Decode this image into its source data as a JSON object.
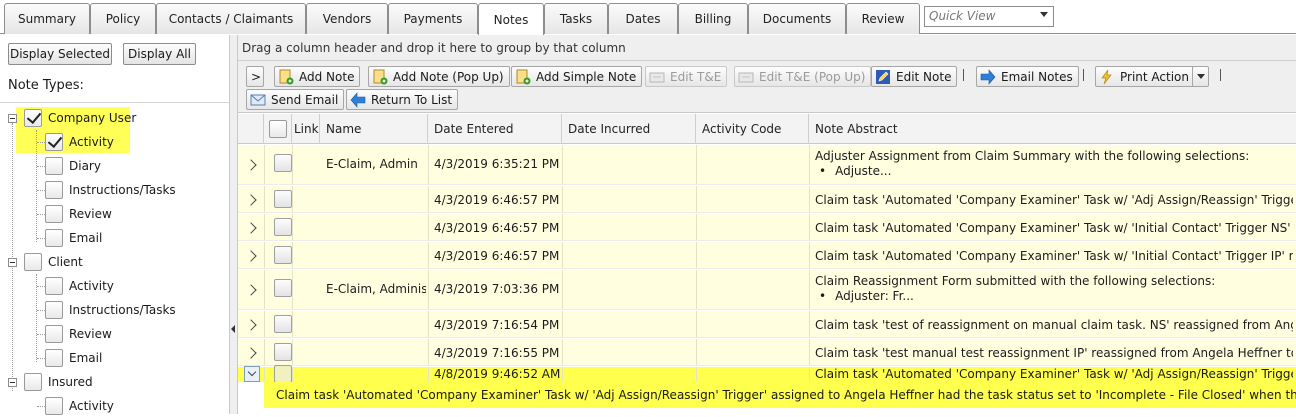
{
  "tabs": [
    {
      "label": "Summary",
      "active": false
    },
    {
      "label": "Policy",
      "active": false
    },
    {
      "label": "Contacts / Claimants",
      "active": false
    },
    {
      "label": "Vendors",
      "active": false
    },
    {
      "label": "Payments",
      "active": false
    },
    {
      "label": "Notes",
      "active": true
    },
    {
      "label": "Tasks",
      "active": false
    },
    {
      "label": "Dates",
      "active": false
    },
    {
      "label": "Billing",
      "active": false
    },
    {
      "label": "Documents",
      "active": false
    },
    {
      "label": "Review",
      "active": false
    }
  ],
  "quick_view": {
    "placeholder": "Quick View"
  },
  "left_panel": {
    "display_selected": "Display Selected",
    "display_all": "Display All",
    "note_types_label": "Note Types:",
    "tree": [
      {
        "label": "Company User",
        "checked": true,
        "highlight": true
      },
      {
        "label": "Activity",
        "checked": true,
        "highlight": true
      },
      {
        "label": "Diary",
        "checked": false
      },
      {
        "label": "Instructions/Tasks",
        "checked": false
      },
      {
        "label": "Review",
        "checked": false
      },
      {
        "label": "Email",
        "checked": false
      },
      {
        "label": "Client",
        "checked": false
      },
      {
        "label": "Activity",
        "checked": false
      },
      {
        "label": "Instructions/Tasks",
        "checked": false
      },
      {
        "label": "Review",
        "checked": false
      },
      {
        "label": "Email",
        "checked": false
      },
      {
        "label": "Insured",
        "checked": false
      },
      {
        "label": "Activity",
        "checked": false
      }
    ]
  },
  "group_hint": "Drag a column header and drop it here to group by that column",
  "toolbar": {
    "expand": ">",
    "add_note": "Add Note",
    "add_note_popup": "Add Note (Pop Up)",
    "add_simple_note": "Add Simple Note",
    "edit_te": "Edit T&E",
    "edit_te_popup": "Edit T&E (Pop Up)",
    "edit_note": "Edit Note",
    "email_notes": "Email Notes",
    "print_action": "Print Action",
    "send_email": "Send Email",
    "return_to_list": "Return To List"
  },
  "columns": [
    "Link",
    "Name",
    "Date Entered",
    "Date Incurred",
    "Activity Code",
    "Note Abstract"
  ],
  "rows": [
    {
      "name": "E-Claim, Admin",
      "date_entered": "4/3/2019 6:35:21 PM",
      "abstract": "Adjuster Assignment from Claim Summary with the following selections:",
      "bullet": "Adjuste..."
    },
    {
      "name": "",
      "date_entered": "4/3/2019 6:46:57 PM",
      "abstract": "Claim task 'Automated 'Company Examiner' Task w/ 'Adj Assign/Reassign' Trigger' ..."
    },
    {
      "name": "",
      "date_entered": "4/3/2019 6:46:57 PM",
      "abstract": "Claim task 'Automated 'Company Examiner' Task w/ 'Initial Contact' Trigger NS' r..."
    },
    {
      "name": "",
      "date_entered": "4/3/2019 6:46:57 PM",
      "abstract": "Claim task 'Automated 'Company Examiner' Task w/ 'Initial Contact' Trigger IP' r..."
    },
    {
      "name": "E-Claim, Administra",
      "date_entered": "4/3/2019 7:03:36 PM",
      "abstract": "Claim Reassignment Form submitted with the following selections:",
      "bullet": "Adjuster: Fr..."
    },
    {
      "name": "",
      "date_entered": "4/3/2019 7:16:54 PM",
      "abstract": "Claim task 'test of reassignment on manual claim task. NS' reassigned from Angel..."
    },
    {
      "name": "",
      "date_entered": "4/3/2019 7:16:55 PM",
      "abstract": "Claim task 'test manual test reassignment IP' reassigned from Angela Heffner to ..."
    },
    {
      "name": "",
      "date_entered": "4/8/2019 9:46:52 AM",
      "abstract": "Claim task 'Automated 'Company Examiner' Task w/ 'Adj Assign/Reassign' Trigger' ...",
      "selected": true
    }
  ],
  "detail_text": "Claim task 'Automated 'Company Examiner' Task w/ 'Adj Assign/Reassign' Trigger' assigned to Angela Heffner had the task status set to 'Incomplete - File Closed' when the claim was Closed.",
  "colors": {
    "row_bg": "#ffffe0",
    "highlight": "#ffff4d",
    "tree_highlight": "#ffff58"
  }
}
